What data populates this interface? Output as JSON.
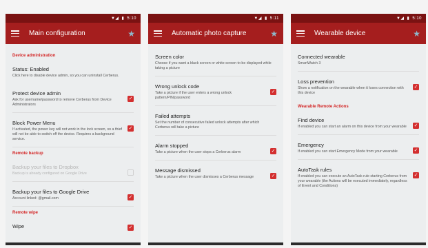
{
  "status": {
    "time1": "5:10",
    "time2": "5:11",
    "time3": "5:10"
  },
  "screens": [
    {
      "title": "Main configuration",
      "sections": [
        {
          "header": "Device administration"
        },
        {
          "title": "Status: Enabled",
          "sub": "Click here to disable device admin, so you can uninstall Cerberus."
        },
        {
          "title": "Protect device admin",
          "sub": "Ask for username/password to remove Cerberus from Device Administrators"
        },
        {
          "title": "Block Power Menu",
          "sub": "If activated, the power key will not work in the lock screen, so a thief will not be able to switch off the device. Requires a background service."
        },
        {
          "header": "Remote backup"
        },
        {
          "title": "Backup your files to Dropbox",
          "sub": "Backup is already configured on Google Drive"
        },
        {
          "title": "Backup your files to Google Drive",
          "sub": "Account linked:           @gmail.com"
        },
        {
          "header": "Remote wipe"
        },
        {
          "title": "Wipe"
        }
      ]
    },
    {
      "title": "Automatic photo capture",
      "items": [
        {
          "title": "Screen color",
          "sub": "Choose if you want a black screen or white screen to be displayed while taking a picture"
        },
        {
          "title": "Wrong unlock code",
          "sub": "Take a picture if the user enters a wrong unlock pattern/PIN/password"
        },
        {
          "title": "Failed attempts",
          "sub": "Set the number of consecutive failed unlock attempts after which Cerberus will take a picture"
        },
        {
          "title": "Alarm stopped",
          "sub": "Take a picture when the user stops a Cerberus alarm"
        },
        {
          "title": "Message dismissed",
          "sub": "Take a picture when the user dismisses a Cerberus message"
        }
      ]
    },
    {
      "title": "Wearable device",
      "items": [
        {
          "title": "Connected wearable",
          "sub": "SmartWatch 3"
        },
        {
          "title": "Loss prevention",
          "sub": "Show a notification on the wearable when it loses connection with this device"
        },
        {
          "header": "Wearable Remote Actions"
        },
        {
          "title": "Find device",
          "sub": "If enabled you can start an alarm on this device from your wearable"
        },
        {
          "title": "Emergency",
          "sub": "If enabled you can start Emergency Mode from your wearable"
        },
        {
          "title": "AutoTask rules",
          "sub": "If enabled you can execute an AutoTask rule starting Cerberus from your wearable (the Actions will be executed immediately, regardless of Event and Conditions)"
        }
      ]
    }
  ]
}
